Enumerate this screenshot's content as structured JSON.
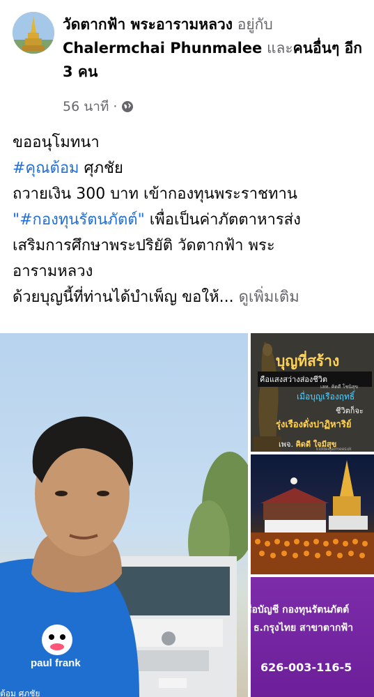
{
  "post": {
    "page_name": "วัดตากฟ้า พระอารามหลวง",
    "with_word": "อยู่กับ",
    "tagged_person": "Chalermchai Phunmalee",
    "and_word": "และ",
    "others": "คนอื่นๆ อีก 3 คน",
    "time": "56 นาที",
    "separator": "·",
    "privacy_icon": "globe-icon"
  },
  "text": {
    "line1": "ขออนุโมทนา",
    "hashtag1": "#คุณต้อม",
    "name_suffix": " ศุภชัย",
    "line3": "ถวายเงิน 300 บาท  เข้ากองทุนพระราชทาน",
    "quote_open": "\"",
    "hashtag2": "#กองทุนรัตนภัตต์",
    "quote_close": "\"",
    "line4_rest": "  เพื่อเป็นค่าภัตตาหารส่ง",
    "line5": "เสริมการศึกษาพระปริยัติ วัดตากฟ้า พระ",
    "line6": "อารามหลวง",
    "line7": " ด้วยบุญนี้ที่ท่านได้บำเพ็ญ ขอให้...",
    "see_more": "ดูเพิ่มเติม"
  },
  "media": {
    "main_caption": "ต้อม ศุภชัย",
    "shirt_text": "paul frank",
    "tile1": {
      "title": "บุญที่สร้าง",
      "sub": "คือแสงสว่างส่องชีวิต",
      "small": "เลท. คิดดี โชนิสุข",
      "l3": "เมื่อบุญเรืองฤทธิ์",
      "l4": "ชีวิตก็จะ",
      "l5": "รุ่งเรืองดั่งปาฏิหาริย์",
      "foot_prefix": "เพจ.",
      "foot_name": "คิดดี ใจมีสุข",
      "foot2": "kiddeejaimeesuk"
    },
    "tile3": {
      "l1": "ชื่อบัญชี กองทุนรัตนภัตต์",
      "l2": "ธ.กรุงไทย สาขาตากฟ้า",
      "account": "626-003-116-5"
    }
  },
  "colors": {
    "link_blue": "#216fdb",
    "meta_gray": "#65676b",
    "text": "#050505",
    "tile_purple": "#7c2ca8",
    "tile_gold": "#ffd35a"
  }
}
